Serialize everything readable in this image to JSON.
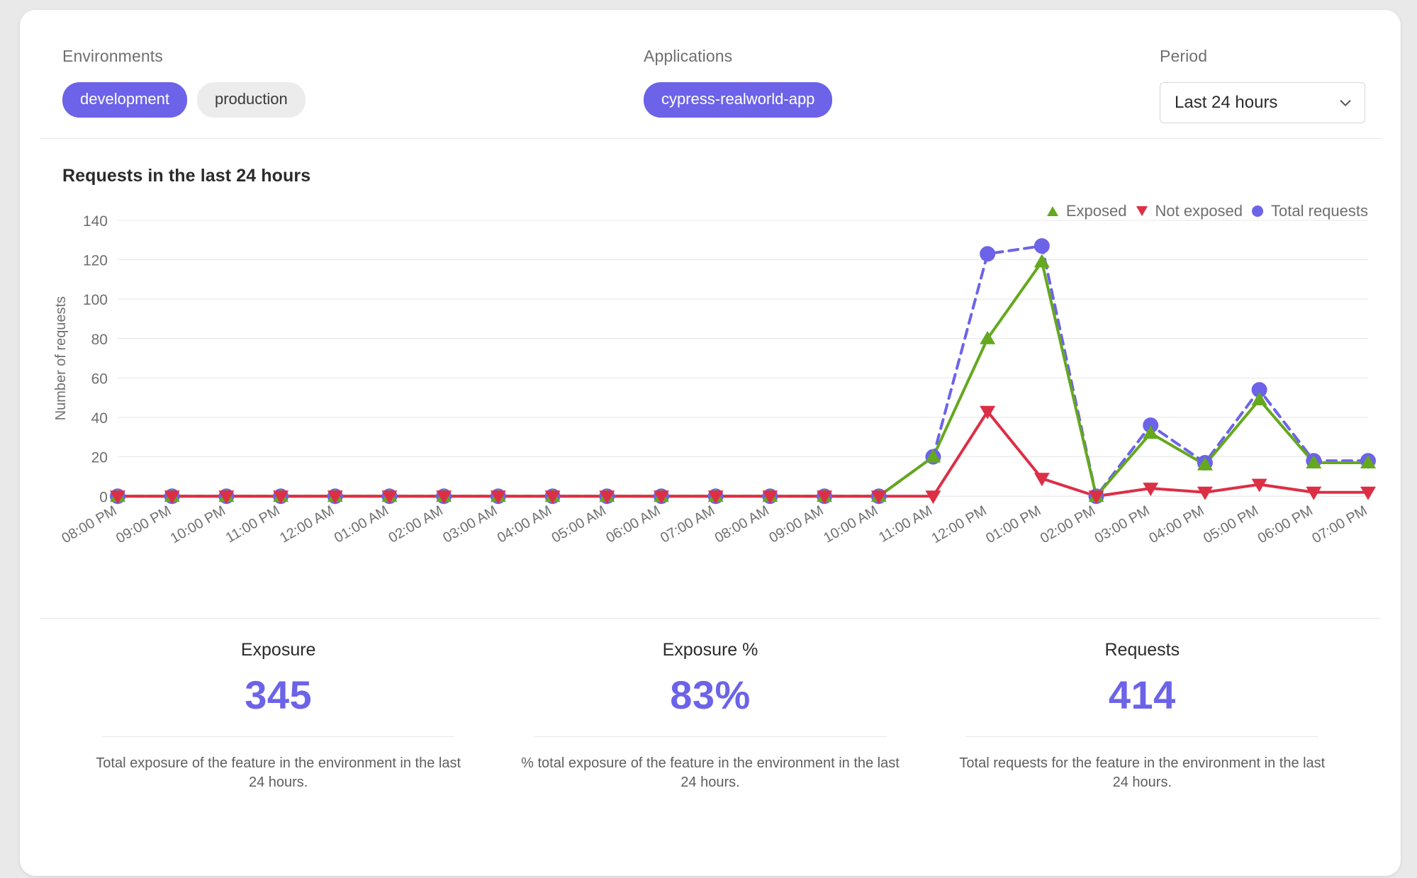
{
  "filters": {
    "environments": {
      "label": "Environments",
      "chips": [
        {
          "label": "development",
          "selected": true
        },
        {
          "label": "production",
          "selected": false
        }
      ]
    },
    "applications": {
      "label": "Applications",
      "chips": [
        {
          "label": "cypress-realworld-app",
          "selected": true
        }
      ]
    },
    "period": {
      "label": "Period",
      "value": "Last 24 hours",
      "chevron_icon": "chevron-down-icon"
    }
  },
  "chart_data": {
    "type": "line",
    "title": "Requests in the last 24 hours",
    "xlabel": "",
    "ylabel": "Number of requests",
    "ylim": [
      0,
      140
    ],
    "yticks": [
      0,
      20,
      40,
      60,
      80,
      100,
      120,
      140
    ],
    "grid": true,
    "legend_position": "top-right",
    "categories": [
      "08:00 PM",
      "09:00 PM",
      "10:00 PM",
      "11:00 PM",
      "12:00 AM",
      "01:00 AM",
      "02:00 AM",
      "03:00 AM",
      "04:00 AM",
      "05:00 AM",
      "06:00 AM",
      "07:00 AM",
      "08:00 AM",
      "09:00 AM",
      "10:00 AM",
      "11:00 AM",
      "12:00 PM",
      "01:00 PM",
      "02:00 PM",
      "03:00 PM",
      "04:00 PM",
      "05:00 PM",
      "06:00 PM",
      "07:00 PM"
    ],
    "series": [
      {
        "name": "Exposed",
        "color": "#64a81e",
        "marker": "triangle-up",
        "dashed": false,
        "values": [
          0,
          0,
          0,
          0,
          0,
          0,
          0,
          0,
          0,
          0,
          0,
          0,
          0,
          0,
          0,
          20,
          80,
          119,
          0,
          32,
          16,
          49,
          17,
          17
        ]
      },
      {
        "name": "Not exposed",
        "color": "#dc2f45",
        "marker": "triangle-down",
        "dashed": false,
        "values": [
          0,
          0,
          0,
          0,
          0,
          0,
          0,
          0,
          0,
          0,
          0,
          0,
          0,
          0,
          0,
          0,
          43,
          9,
          0,
          4,
          2,
          6,
          2,
          2
        ]
      },
      {
        "name": "Total requests",
        "color": "#6c63e8",
        "marker": "circle",
        "dashed": true,
        "values": [
          0,
          0,
          0,
          0,
          0,
          0,
          0,
          0,
          0,
          0,
          0,
          0,
          0,
          0,
          0,
          20,
          123,
          127,
          0,
          36,
          17,
          54,
          18,
          18
        ]
      }
    ]
  },
  "metrics": [
    {
      "title": "Exposure",
      "value": "345",
      "description": "Total exposure of the feature in the environment in the last 24 hours."
    },
    {
      "title": "Exposure %",
      "value": "83%",
      "description": "% total exposure of the feature in the environment in the last 24 hours."
    },
    {
      "title": "Requests",
      "value": "414",
      "description": "Total requests for the feature in the environment in the last 24 hours."
    }
  ]
}
